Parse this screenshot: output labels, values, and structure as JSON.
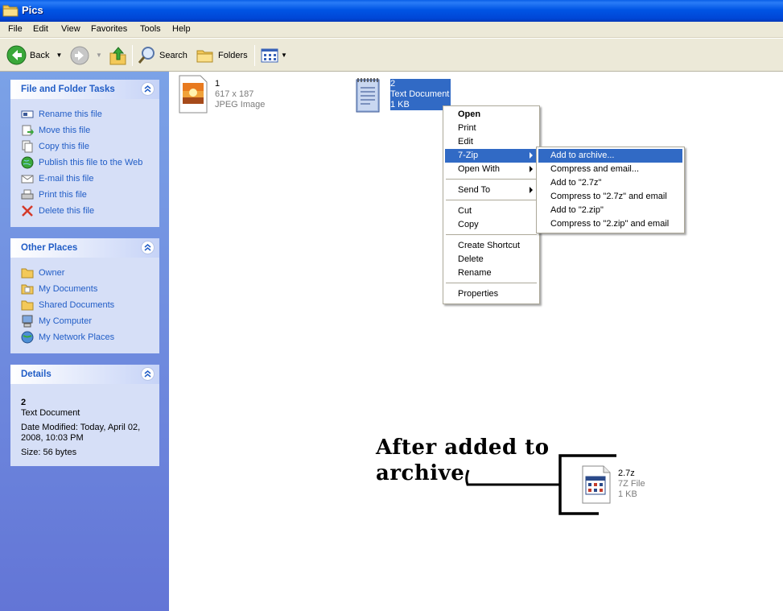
{
  "window": {
    "title": "Pics"
  },
  "menubar": [
    "File",
    "Edit",
    "View",
    "Favorites",
    "Tools",
    "Help"
  ],
  "toolbar": {
    "back": "Back",
    "search": "Search",
    "folders": "Folders"
  },
  "tasks": {
    "title": "File and Folder Tasks",
    "items": [
      "Rename this file",
      "Move this file",
      "Copy this file",
      "Publish this file to the Web",
      "E-mail this file",
      "Print this file",
      "Delete this file"
    ]
  },
  "places": {
    "title": "Other Places",
    "items": [
      "Owner",
      "My Documents",
      "Shared Documents",
      "My Computer",
      "My Network Places"
    ]
  },
  "details": {
    "title": "Details",
    "name": "2",
    "type": "Text Document",
    "modified_line1": "Date Modified: Today, April 02,",
    "modified_line2": "2008, 10:03 PM",
    "size": "Size: 56 bytes"
  },
  "files": [
    {
      "name": "1",
      "line2": "617 x 187",
      "line3": "JPEG Image"
    },
    {
      "name": "2",
      "line2": "Text Document",
      "line3": "1 KB"
    },
    {
      "name": "2.7z",
      "line2": "7Z File",
      "line3": "1 KB"
    }
  ],
  "context_menu": {
    "items": [
      "Open",
      "Print",
      "Edit",
      "7-Zip",
      "Open With",
      "Send To",
      "Cut",
      "Copy",
      "Create Shortcut",
      "Delete",
      "Rename",
      "Properties"
    ]
  },
  "submenu": {
    "items": [
      "Add to archive...",
      "Compress and email...",
      "Add to \"2.7z\"",
      "Compress to \"2.7z\" and email",
      "Add to \"2.zip\"",
      "Compress to \"2.zip\" and email"
    ]
  },
  "annotation": {
    "line1": "After added to",
    "line2": "archive"
  },
  "colors": {
    "titlebar": "#0055e5",
    "selection": "#316ac5",
    "panel_link": "#215dc6",
    "panel_bg": "#6375d6"
  }
}
